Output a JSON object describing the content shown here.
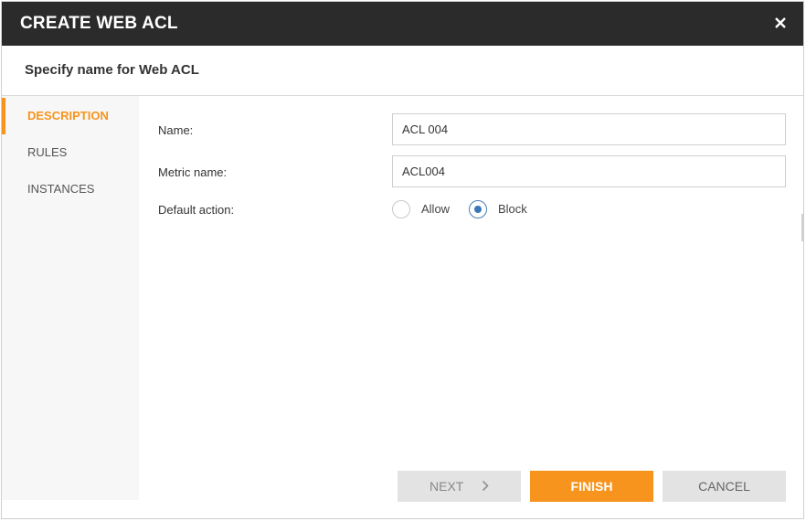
{
  "dialog": {
    "title": "CREATE WEB ACL",
    "subtitle": "Specify name for Web ACL",
    "close_icon": "close-icon"
  },
  "sidebar": {
    "items": [
      {
        "label": "DESCRIPTION",
        "active": true
      },
      {
        "label": "RULES",
        "active": false
      },
      {
        "label": "INSTANCES",
        "active": false
      }
    ]
  },
  "form": {
    "name_label": "Name:",
    "name_value": "ACL 004",
    "metric_label": "Metric name:",
    "metric_value": "ACL004",
    "action_label": "Default action:",
    "options": [
      {
        "label": "Allow",
        "checked": false
      },
      {
        "label": "Block",
        "checked": true
      }
    ]
  },
  "buttons": {
    "next": "NEXT",
    "finish": "FINISH",
    "cancel": "CANCEL"
  },
  "colors": {
    "accent": "#f7941d",
    "titlebar": "#2b2b2b",
    "radio_selected": "#3a78b8"
  }
}
